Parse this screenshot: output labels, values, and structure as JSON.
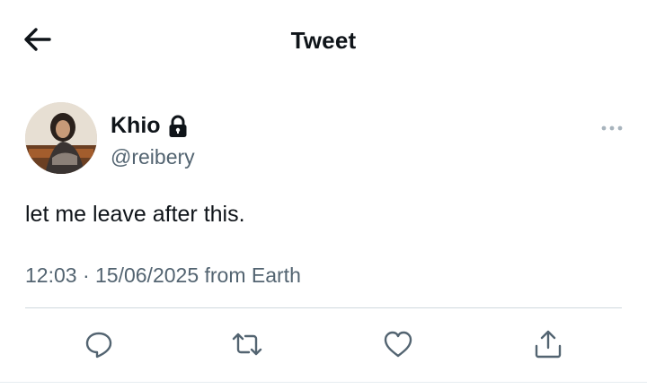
{
  "header": {
    "title": "Tweet",
    "back_icon": "arrow-left-icon"
  },
  "author": {
    "display_name": "Khio",
    "handle": "@reibery",
    "protected_icon": "lock-icon"
  },
  "tweet": {
    "text": "let me leave after this.",
    "meta": "12:03 · 15/06/2025 from Earth"
  },
  "actions": [
    "reply-icon",
    "retweet-icon",
    "like-icon",
    "share-icon"
  ],
  "colors": {
    "text": "#0f1419",
    "secondary": "#536471",
    "divider": "#cfd9de"
  }
}
